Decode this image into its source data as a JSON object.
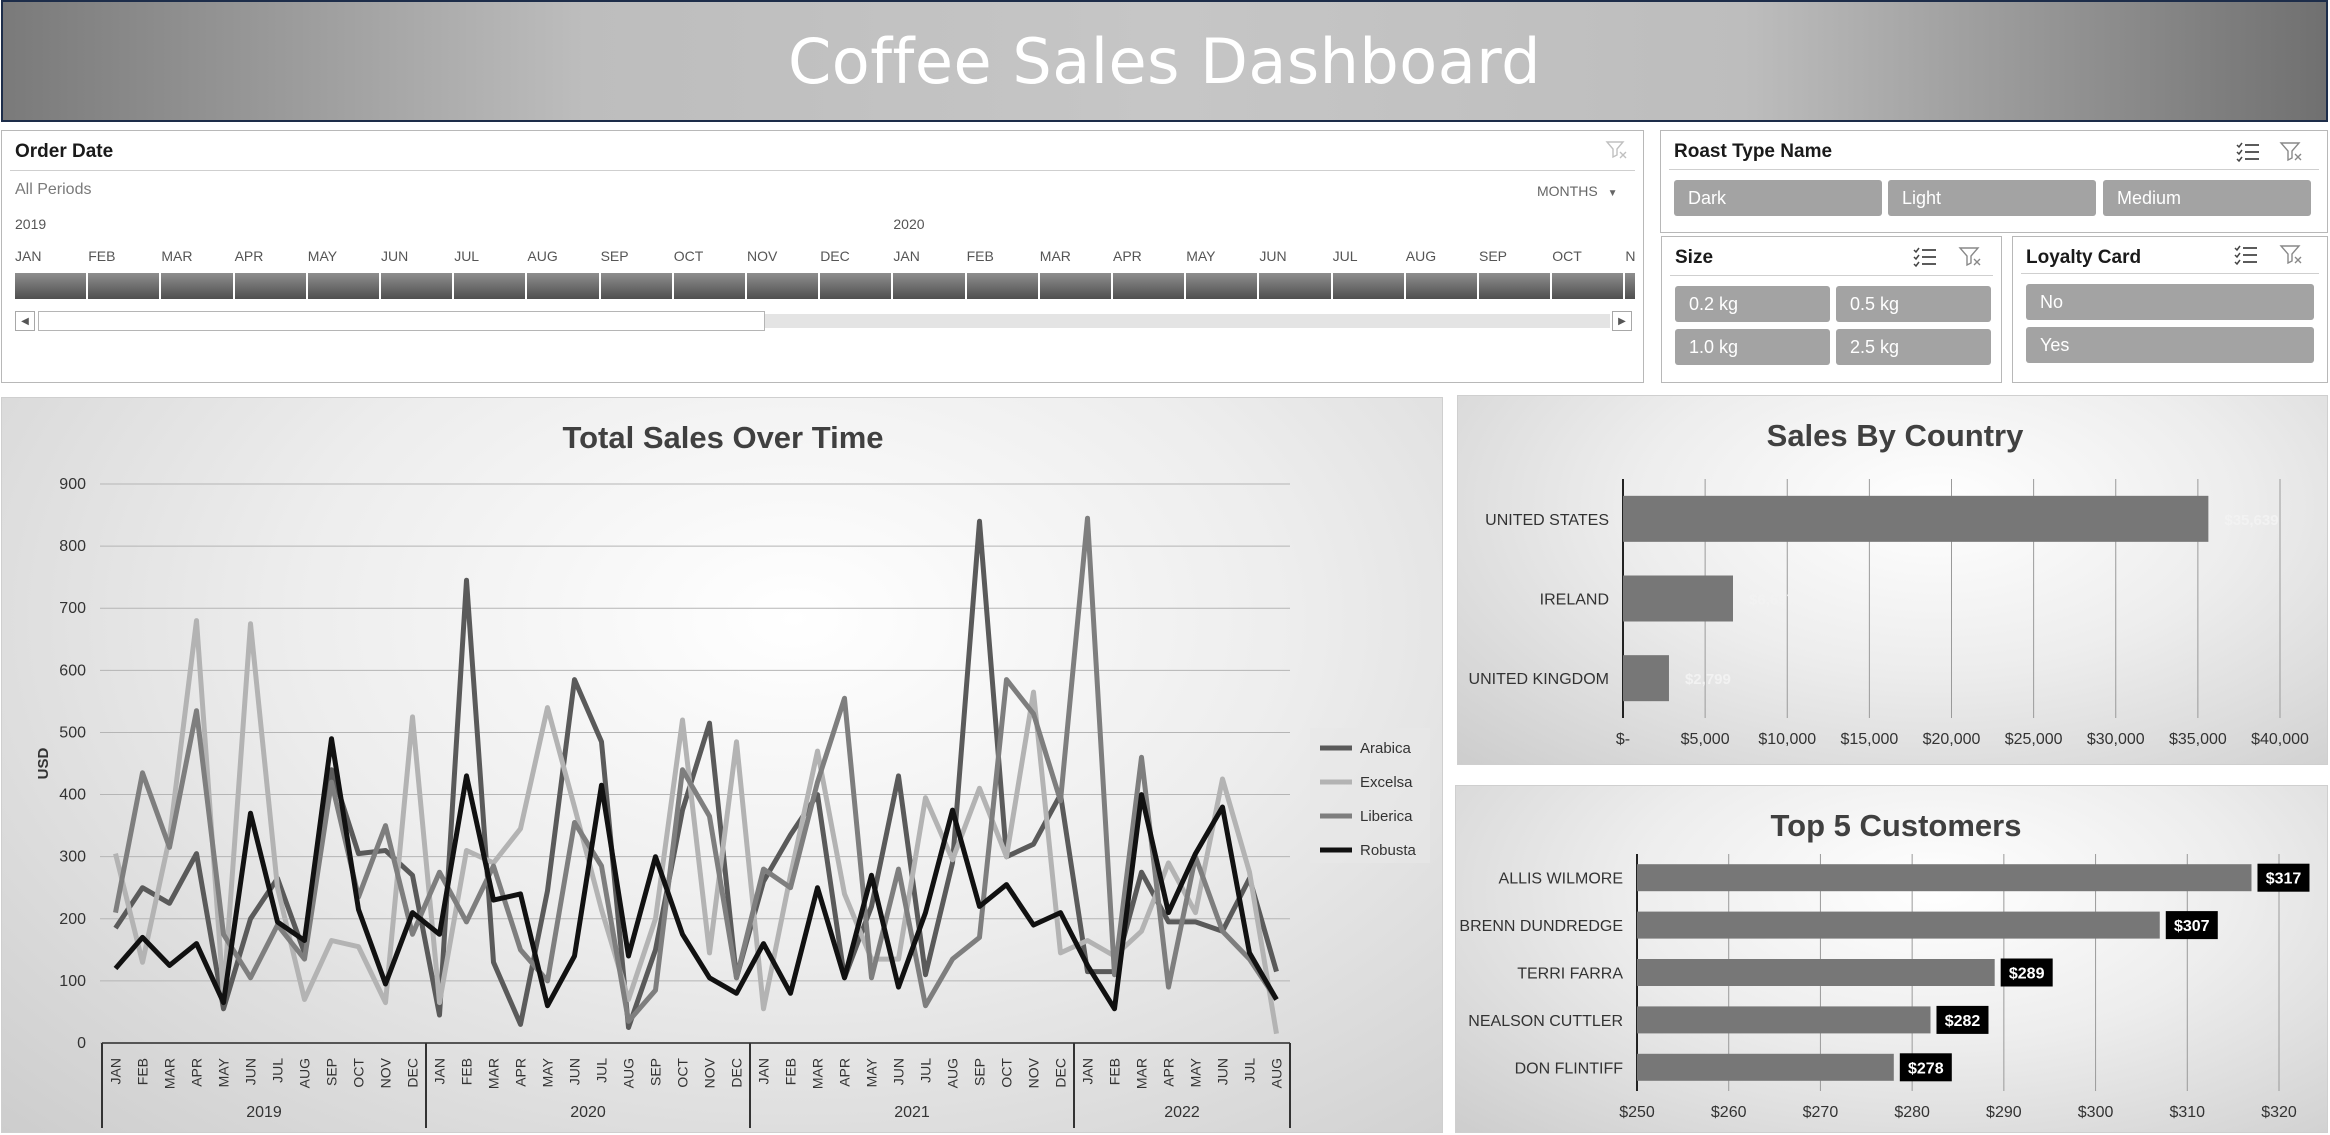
{
  "dashboard": {
    "title": "Coffee Sales Dashboard"
  },
  "timeline": {
    "title": "Order Date",
    "period": "All Periods",
    "level": "MONTHS",
    "years": [
      "2019",
      "2020"
    ],
    "months": [
      "JAN",
      "FEB",
      "MAR",
      "APR",
      "MAY",
      "JUN",
      "JUL",
      "AUG",
      "SEP",
      "OCT",
      "NOV",
      "DEC",
      "JAN",
      "FEB",
      "MAR",
      "APR",
      "MAY",
      "JUN",
      "JUL",
      "AUG",
      "SEP",
      "OCT",
      "N"
    ]
  },
  "slicers": {
    "roast": {
      "title": "Roast Type Name",
      "items": [
        "Dark",
        "Light",
        "Medium"
      ]
    },
    "size": {
      "title": "Size",
      "items": [
        "0.2 kg",
        "0.5 kg",
        "1.0 kg",
        "2.5 kg"
      ]
    },
    "loyalty": {
      "title": "Loyalty Card",
      "items": [
        "No",
        "Yes"
      ]
    }
  },
  "colors": {
    "arabica": "#5a5a5a",
    "excelsa": "#b3b3b3",
    "liberica": "#7e7e7e",
    "robusta": "#111111",
    "bar": "#777777",
    "label_box": "#000000"
  },
  "chart_data": [
    {
      "type": "line",
      "title": "Total Sales Over Time",
      "ylabel": "USD",
      "ylim": [
        0,
        900
      ],
      "yticks": [
        0,
        100,
        200,
        300,
        400,
        500,
        600,
        700,
        800,
        900
      ],
      "grid": true,
      "legend": "right",
      "month_labels": [
        "JAN",
        "FEB",
        "MAR",
        "APR",
        "MAY",
        "JUN",
        "JUL",
        "AUG",
        "SEP",
        "OCT",
        "NOV",
        "DEC"
      ],
      "years": [
        {
          "label": "2019",
          "months": 12
        },
        {
          "label": "2020",
          "months": 12
        },
        {
          "label": "2021",
          "months": 12
        },
        {
          "label": "2022",
          "months": 8
        }
      ],
      "series": [
        {
          "name": "Arabica",
          "values": [
            185,
            250,
            225,
            305,
            55,
            200,
            265,
            145,
            440,
            305,
            310,
            270,
            45,
            745,
            130,
            30,
            245,
            585,
            485,
            25,
            150,
            375,
            515,
            105,
            260,
            335,
            400,
            105,
            220,
            430,
            110,
            290,
            840,
            300,
            320,
            400,
            115,
            115,
            275,
            195,
            195,
            180,
            265,
            115
          ]
        },
        {
          "name": "Excelsa",
          "values": [
            305,
            130,
            330,
            680,
            75,
            675,
            250,
            70,
            165,
            155,
            65,
            525,
            65,
            310,
            290,
            345,
            540,
            380,
            215,
            70,
            200,
            520,
            145,
            485,
            55,
            270,
            470,
            240,
            135,
            135,
            395,
            295,
            410,
            300,
            565,
            145,
            165,
            140,
            180,
            290,
            210,
            425,
            275,
            15
          ]
        },
        {
          "name": "Liberica",
          "values": [
            210,
            435,
            315,
            535,
            175,
            105,
            190,
            135,
            420,
            235,
            350,
            175,
            275,
            195,
            285,
            150,
            100,
            355,
            285,
            35,
            85,
            440,
            365,
            105,
            280,
            250,
            420,
            555,
            105,
            280,
            60,
            135,
            170,
            585,
            530,
            390,
            845,
            110,
            460,
            90,
            300,
            180,
            135,
            70
          ]
        },
        {
          "name": "Robusta",
          "values": [
            120,
            170,
            125,
            160,
            65,
            370,
            195,
            165,
            490,
            215,
            95,
            210,
            175,
            430,
            230,
            240,
            60,
            140,
            415,
            140,
            300,
            175,
            105,
            80,
            160,
            80,
            250,
            105,
            270,
            90,
            210,
            375,
            220,
            255,
            190,
            210,
            125,
            55,
            400,
            210,
            305,
            380,
            145,
            70
          ]
        }
      ]
    },
    {
      "type": "bar",
      "orientation": "horizontal",
      "title": "Sales By Country",
      "categories": [
        "UNITED STATES",
        "IRELAND",
        "UNITED KINGDOM"
      ],
      "values": [
        35639,
        6697,
        2799
      ],
      "value_labels": [
        "$35,639",
        "$6,697",
        "$2,799"
      ],
      "xlim": [
        0,
        40000
      ],
      "xticks": [
        0,
        5000,
        10000,
        15000,
        20000,
        25000,
        30000,
        35000,
        40000
      ],
      "xtick_labels": [
        "$-",
        "$5,000",
        "$10,000",
        "$15,000",
        "$20,000",
        "$25,000",
        "$30,000",
        "$35,000",
        "$40,000"
      ],
      "grid": true
    },
    {
      "type": "bar",
      "orientation": "horizontal",
      "title": "Top 5 Customers",
      "categories": [
        "ALLIS WILMORE",
        "BRENN DUNDREDGE",
        "TERRI FARRA",
        "NEALSON CUTTLER",
        "DON FLINTIFF"
      ],
      "values": [
        317,
        307,
        289,
        282,
        278
      ],
      "value_labels": [
        "$317",
        "$307",
        "$289",
        "$282",
        "$278"
      ],
      "xlim": [
        250,
        320
      ],
      "xticks": [
        250,
        260,
        270,
        280,
        290,
        300,
        310,
        320
      ],
      "xtick_labels": [
        "$250",
        "$260",
        "$270",
        "$280",
        "$290",
        "$300",
        "$310",
        "$320"
      ],
      "grid": true
    }
  ]
}
